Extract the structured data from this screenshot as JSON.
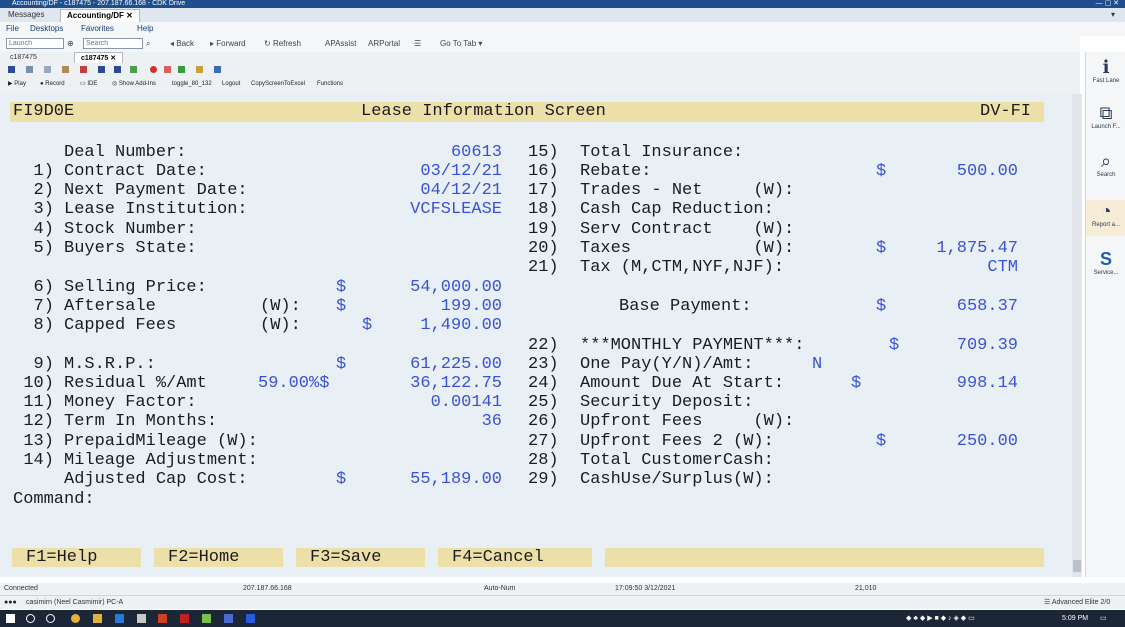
{
  "window": {
    "title": "Accounting/DF - c187475 - 207.187.66.168 - CDK Drive"
  },
  "tabs": [
    {
      "label": "Messages"
    },
    {
      "label": "Accounting/DF"
    }
  ],
  "menu": {
    "file": "File",
    "desktops": "Desktops",
    "favorites": "Favorites",
    "help": "Help"
  },
  "toolbar": {
    "launch_placeholder": "Launch",
    "search_placeholder": "Search",
    "back": "Back",
    "forward": "Forward",
    "refresh": "Refresh",
    "apassist": "APAssist",
    "arportal": "ARPortal",
    "goto_tab": "Go To Tab"
  },
  "doc_tabs": [
    {
      "label": "c187475"
    },
    {
      "label": "c187475"
    }
  ],
  "tool_row": {
    "play": "Play",
    "record": "Record",
    "ide": "IDE",
    "show_addins": "Show Add-Ins",
    "toggle": "toggle_80_132",
    "logout": "Logout",
    "copyscreen": "CopyScreenToExcel",
    "functions": "Functions"
  },
  "screen": {
    "code": "FI9D0E",
    "title": "Lease Information Screen",
    "right_code": "DV-FI",
    "left_fields": [
      {
        "num": "",
        "label": "Deal Number:",
        "wflag": "",
        "dollar": "",
        "value": "60613"
      },
      {
        "num": "1)",
        "label": "Contract Date:",
        "wflag": "",
        "dollar": "",
        "value": "03/12/21"
      },
      {
        "num": "2)",
        "label": "Next Payment Date:",
        "wflag": "",
        "dollar": "",
        "value": "04/12/21"
      },
      {
        "num": "3)",
        "label": "Lease Institution:",
        "wflag": "",
        "dollar": "",
        "value": "VCFSLEASE"
      },
      {
        "num": "4)",
        "label": "Stock Number:",
        "wflag": "",
        "dollar": "",
        "value": ""
      },
      {
        "num": "5)",
        "label": "Buyers State:",
        "wflag": "",
        "dollar": "",
        "value": ""
      },
      {
        "num": "6)",
        "label": "Selling Price:",
        "wflag": "",
        "dollar": "$",
        "value": "54,000.00"
      },
      {
        "num": "7)",
        "label": "Aftersale",
        "wflag": "(W):",
        "dollar": "$",
        "value": "199.00"
      },
      {
        "num": "8)",
        "label": "Capped Fees",
        "wflag": "(W):",
        "dollar": "$",
        "value": "1,490.00"
      },
      {
        "num": "9)",
        "label": "M.S.R.P.:",
        "wflag": "",
        "dollar": "$",
        "value": "61,225.00"
      },
      {
        "num": "10)",
        "label": "Residual %/Amt",
        "wflag": "",
        "dollar": "",
        "value": "36,122.75"
      },
      {
        "num": "11)",
        "label": "Money Factor:",
        "wflag": "",
        "dollar": "",
        "value": "0.00141"
      },
      {
        "num": "12)",
        "label": "Term In Months:",
        "wflag": "",
        "dollar": "",
        "value": "36"
      },
      {
        "num": "13)",
        "label": "PrepaidMileage (W):",
        "wflag": "",
        "dollar": "",
        "value": ""
      },
      {
        "num": "14)",
        "label": "Mileage Adjustment:",
        "wflag": "",
        "dollar": "",
        "value": ""
      },
      {
        "num": "",
        "label": "Adjusted Cap Cost:",
        "wflag": "",
        "dollar": "$",
        "value": "55,189.00"
      }
    ],
    "residual_pct": "59.00%$",
    "right_fields": [
      {
        "num": "15)",
        "label": "Total Insurance:",
        "dollar": "",
        "value": ""
      },
      {
        "num": "16)",
        "label": "Rebate:",
        "dollar": "$",
        "value": "500.00"
      },
      {
        "num": "17)",
        "label": "Trades - Net     (W):",
        "dollar": "",
        "value": ""
      },
      {
        "num": "18)",
        "label": "Cash Cap Reduction:",
        "dollar": "",
        "value": ""
      },
      {
        "num": "19)",
        "label": "Serv Contract    (W):",
        "dollar": "",
        "value": ""
      },
      {
        "num": "20)",
        "label": "Taxes            (W):",
        "dollar": "$",
        "value": "1,875.47"
      },
      {
        "num": "21)",
        "label": "Tax (M,CTM,NYF,NJF):",
        "dollar": "",
        "value": "CTM"
      },
      {
        "num": "",
        "label": "Base Payment:",
        "dollar": "$",
        "value": "658.37"
      },
      {
        "num": "22)",
        "label": "***MONTHLY PAYMENT***:",
        "dollar": "$",
        "value": "709.39"
      },
      {
        "num": "23)",
        "label": "One Pay(Y/N)/Amt:",
        "dollar": "",
        "value": "N"
      },
      {
        "num": "24)",
        "label": "Amount Due At Start:",
        "dollar": "$",
        "value": "998.14"
      },
      {
        "num": "25)",
        "label": "Security Deposit:",
        "dollar": "",
        "value": ""
      },
      {
        "num": "26)",
        "label": "Upfront Fees     (W):",
        "dollar": "",
        "value": ""
      },
      {
        "num": "27)",
        "label": "Upfront Fees 2 (W):",
        "dollar": "$",
        "value": "250.00"
      },
      {
        "num": "28)",
        "label": "Total CustomerCash:",
        "dollar": "",
        "value": ""
      },
      {
        "num": "29)",
        "label": "CashUse/Surplus(W):",
        "dollar": "",
        "value": ""
      }
    ],
    "command_label": "Command:",
    "fkeys": [
      {
        "label": "F1=Help"
      },
      {
        "label": "F2=Home"
      },
      {
        "label": "F3=Save"
      },
      {
        "label": "F4=Cancel"
      }
    ]
  },
  "side_panel": [
    {
      "label": "Fast Lane",
      "icon": "info-icon"
    },
    {
      "label": "Launch F...",
      "icon": "launch-icon"
    },
    {
      "label": "Search",
      "icon": "search-icon"
    },
    {
      "label": "Report a...",
      "icon": "report-icon"
    },
    {
      "label": "Service...",
      "icon": "service-icon"
    }
  ],
  "status": {
    "connected": "Connected",
    "ip": "207.187.66.168",
    "mode": "Auto-Num",
    "datetime": "17:09:50 3/12/2021",
    "pos": "21,010",
    "user": "casimirn (Neel Casmimir)  PC-A",
    "edition": "Advanced Elite  2/0"
  },
  "taskbar": {
    "time": "5:09 PM"
  },
  "colors": {
    "header_band": "#ecdfa8",
    "value_blue": "#3a52d6",
    "terminal_bg": "#e8f0f6"
  }
}
